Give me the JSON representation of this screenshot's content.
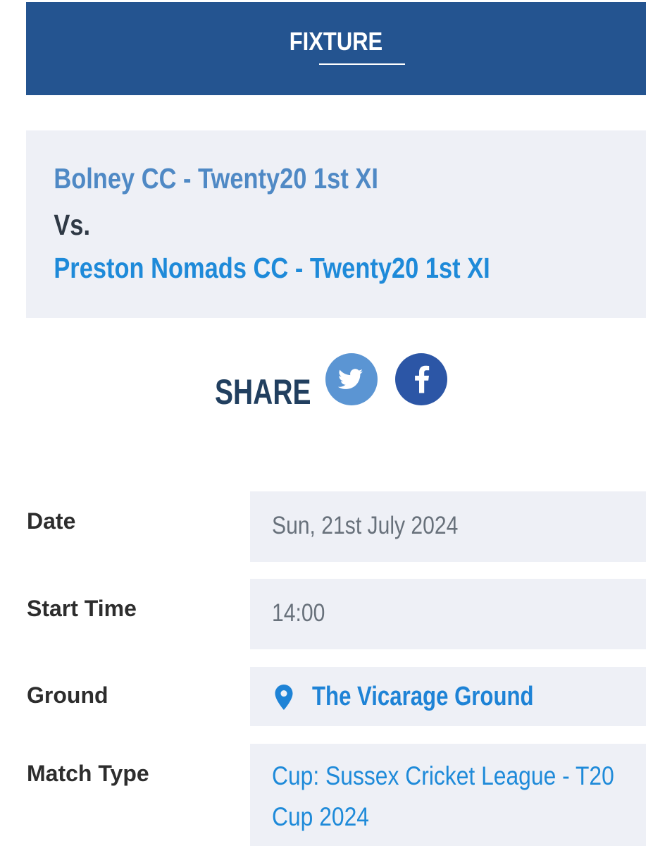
{
  "header": {
    "title": "FIXTURE"
  },
  "match": {
    "home_team": "Bolney CC - Twenty20 1st XI",
    "versus": "Vs.",
    "away_team": "Preston Nomads CC - Twenty20 1st XI"
  },
  "share": {
    "label": "SHARE",
    "buttons": [
      {
        "name": "twitter",
        "icon": "twitter-bird-icon",
        "color": "#5B95D3"
      },
      {
        "name": "facebook",
        "icon": "facebook-f-icon",
        "color": "#2C56A6"
      }
    ]
  },
  "details": {
    "date_label": "Date",
    "date_value": "Sun, 21st July 2024",
    "start_time_label": "Start Time",
    "start_time_value": "14:00",
    "ground_label": "Ground",
    "ground_value": "The Vicarage Ground",
    "ground_icon": "map-pin-icon",
    "match_type_label": "Match Type",
    "match_type_line1": "Cup: Sussex Cricket League - T20",
    "match_type_line2": "Cup 2024"
  },
  "colors": {
    "header_blue": "#245490",
    "panel_gray": "#EEF0F6",
    "link_blue": "#1E8AD9",
    "home_team_blue": "#4F89C5",
    "share_dark": "#213F5F"
  }
}
